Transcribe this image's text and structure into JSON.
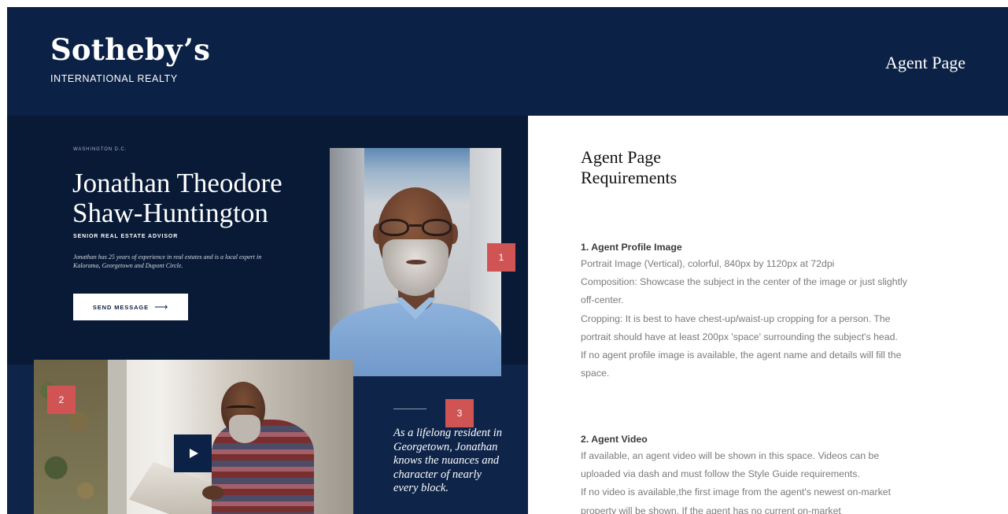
{
  "header": {
    "logo_name": "Sotheby’s",
    "logo_sub": "INTERNATIONAL REALTY",
    "page_title": "Agent Page"
  },
  "agent_preview": {
    "location": "WASHINGTON D.C.",
    "name": "Jonathan Theodore Shaw-Huntington",
    "role": "SENIOR REAL ESTATE ADVISOR",
    "bio": "Jonathan has 25 years of experience in real estates and is a local expert in Kalorama, Georgetown and Dupont Circle.",
    "send_button": "SEND MESSAGE",
    "quote": "As a lifelong resident in Georgetown, Jonathan knows the nuances and character of nearly every block.",
    "markers": [
      "1",
      "2",
      "3"
    ]
  },
  "requirements": {
    "title": "Agent Page Requirements",
    "sections": [
      {
        "heading": "1.  Agent Profile Image",
        "lines": [
          "Portrait Image (Vertical), colorful, 840px by 1120px at 72dpi",
          "Composition: Showcase the subject in the center of the image or just slightly off-center.",
          "Cropping: It is best to have chest-up/waist-up cropping for a person. The portrait should have at least 200px 'space' surrounding the subject's head.",
          "If no agent profile image is available, the agent name and details will fill the space."
        ]
      },
      {
        "heading": "2.  Agent Video",
        "lines": [
          "If available, an agent video will be shown in this space. Videos can be uploaded via dash and must follow the Style Guide requirements.",
          "If no video is available,the first image from the agent's newest on-market property will be shown. If the agent has no current on-market"
        ]
      }
    ]
  },
  "colors": {
    "navy": "#0b2145",
    "dark_navy": "#081a36",
    "marker_red": "#d05454"
  }
}
